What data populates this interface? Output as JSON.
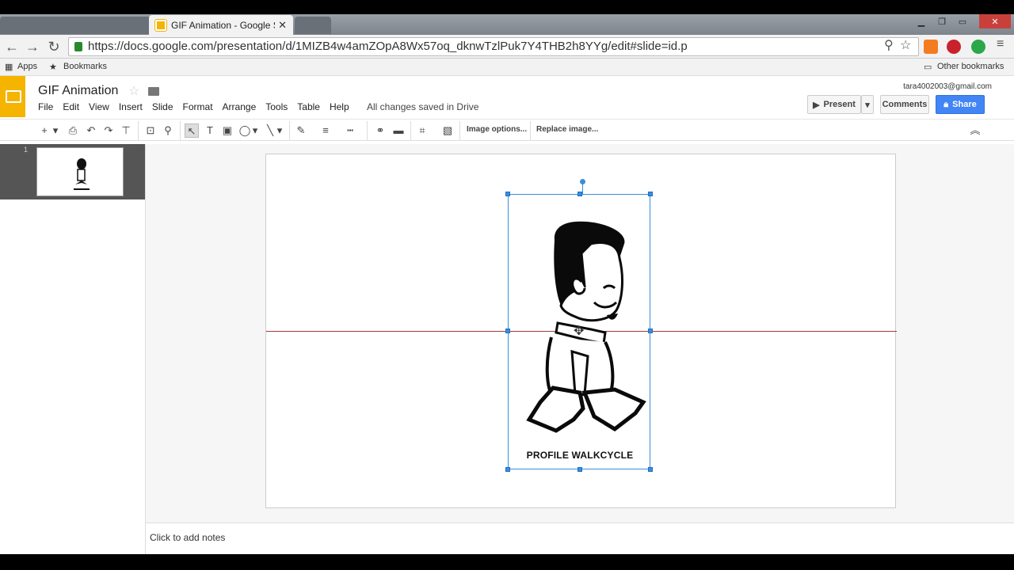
{
  "browser": {
    "tab_title": "GIF Animation - Google S",
    "url": "https://docs.google.com/presentation/d/1MIZB4w4amZOpA8Wx57oq_dknwTzlPuk7Y4THB2h8YYg/edit#slide=id.p",
    "bookmarks": {
      "apps": "Apps",
      "bookmarks": "Bookmarks",
      "other": "Other bookmarks"
    }
  },
  "doc": {
    "title": "GIF Animation",
    "menu": [
      "File",
      "Edit",
      "View",
      "Insert",
      "Slide",
      "Format",
      "Arrange",
      "Tools",
      "Table",
      "Help"
    ],
    "save_status": "All changes saved in Drive",
    "account_email": "tara4002003@gmail.com",
    "present_label": "Present",
    "comments_label": "Comments",
    "share_label": "Share"
  },
  "toolbar": {
    "image_options": "Image options...",
    "replace_image": "Replace image..."
  },
  "filmstrip": {
    "slide_number": "1"
  },
  "slide": {
    "image_caption": "PROFILE WALKCYCLE"
  },
  "notes": {
    "placeholder": "Click to add notes"
  },
  "colors": {
    "slides_brand": "#f4b400",
    "share_button": "#4285f4",
    "selection": "#3b8ed9",
    "guide_line": "#a03a3a"
  }
}
